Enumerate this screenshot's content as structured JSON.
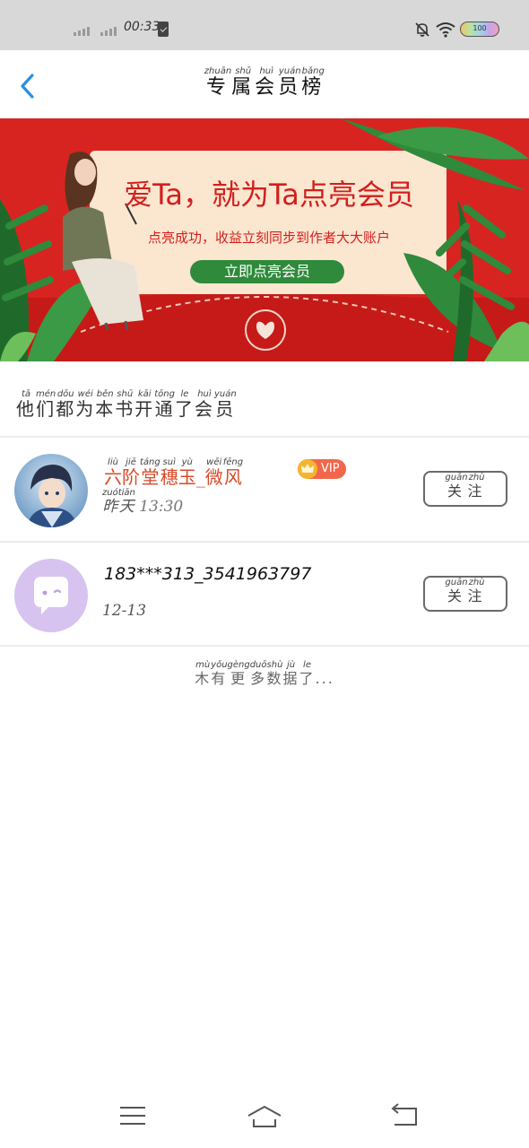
{
  "status_bar": {
    "time": "00:33",
    "battery_level": "100"
  },
  "header": {
    "title_chars": [
      {
        "char": "专",
        "pinyin": "zhuān"
      },
      {
        "char": "属",
        "pinyin": "shǔ"
      },
      {
        "char": "会",
        "pinyin": "huì"
      },
      {
        "char": "员",
        "pinyin": "yuán"
      },
      {
        "char": "榜",
        "pinyin": "bǎng"
      }
    ]
  },
  "banner": {
    "headline": "爱Ta，就为Ta点亮会员",
    "subtitle": "点亮成功，收益立刻同步到作者大大账户",
    "cta_label": "立即点亮会员",
    "accent_color": "#d72420",
    "cta_color": "#2f8a3b"
  },
  "section_title": [
    {
      "char": "他",
      "pinyin": "tā"
    },
    {
      "char": "们",
      "pinyin": "mén"
    },
    {
      "char": "都",
      "pinyin": "dōu"
    },
    {
      "char": "为",
      "pinyin": "wéi"
    },
    {
      "char": "本",
      "pinyin": "běn"
    },
    {
      "char": "书",
      "pinyin": "shū"
    },
    {
      "char": "开",
      "pinyin": "kāi"
    },
    {
      "char": "通",
      "pinyin": "tōng"
    },
    {
      "char": "了",
      "pinyin": "le"
    },
    {
      "char": "会",
      "pinyin": "huì"
    },
    {
      "char": "员",
      "pinyin": "yuán"
    }
  ],
  "members": [
    {
      "name_chars": [
        {
          "char": "六",
          "pinyin": "liù"
        },
        {
          "char": "阶",
          "pinyin": "jiē"
        },
        {
          "char": "堂",
          "pinyin": "táng"
        },
        {
          "char": "穗",
          "pinyin": "suì"
        },
        {
          "char": "玉",
          "pinyin": "yù"
        },
        {
          "char": "_",
          "pinyin": ""
        },
        {
          "char": "微",
          "pinyin": "wēi"
        },
        {
          "char": "风",
          "pinyin": "fēng"
        }
      ],
      "badge": "VIP",
      "time_chars": [
        {
          "char": "昨",
          "pinyin": "zuó"
        },
        {
          "char": "天",
          "pinyin": "tiān"
        }
      ],
      "time_value": "13:30",
      "follow_chars": [
        {
          "char": "关",
          "pinyin": "guān"
        },
        {
          "char": "注",
          "pinyin": "zhù"
        }
      ]
    },
    {
      "name": "183***313_3541963797",
      "time_value": "12-13",
      "follow_chars": [
        {
          "char": "关",
          "pinyin": "guān"
        },
        {
          "char": "注",
          "pinyin": "zhù"
        }
      ]
    }
  ],
  "no_more_chars": [
    {
      "char": "木",
      "pinyin": "mù"
    },
    {
      "char": "有",
      "pinyin": "yǒu"
    },
    {
      "char": "更",
      "pinyin": "gèng"
    },
    {
      "char": "多",
      "pinyin": "duō"
    },
    {
      "char": "数",
      "pinyin": "shù"
    },
    {
      "char": "据",
      "pinyin": "jù"
    },
    {
      "char": "了",
      "pinyin": "le"
    },
    {
      "char": "...",
      "pinyin": ""
    }
  ],
  "icons": {
    "back": "chevron-left-icon",
    "menu": "menu-icon",
    "home": "home-icon",
    "return": "back-arrow-icon"
  }
}
